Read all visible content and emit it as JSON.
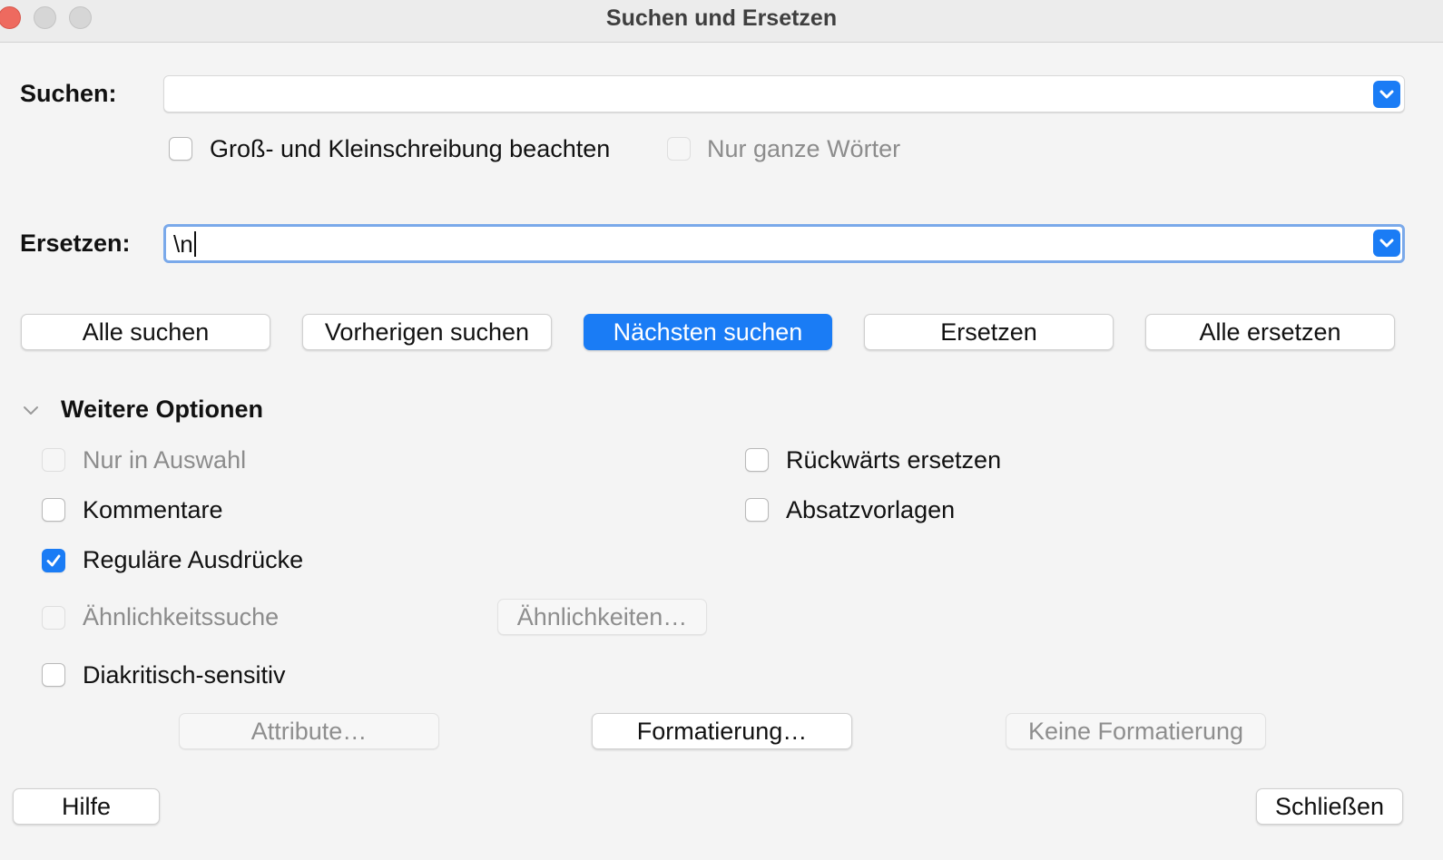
{
  "window": {
    "title": "Suchen und Ersetzen"
  },
  "search": {
    "label": "Suchen:",
    "value": "",
    "dropdown_icon": "chevron-down-icon",
    "match_case": {
      "label": "Groß- und Kleinschreibung beachten",
      "checked": false,
      "enabled": true
    },
    "whole_words": {
      "label": "Nur ganze Wörter",
      "checked": false,
      "enabled": false
    }
  },
  "replace": {
    "label": "Ersetzen:",
    "value": "\\n",
    "dropdown_icon": "chevron-down-icon"
  },
  "actions": {
    "find_all": "Alle suchen",
    "find_previous": "Vorherigen suchen",
    "find_next": "Nächsten suchen",
    "replace": "Ersetzen",
    "replace_all": "Alle ersetzen"
  },
  "more_options": {
    "title": "Weitere Optionen",
    "expanded": true,
    "current_selection_only": {
      "label": "Nur in Auswahl",
      "checked": false,
      "enabled": false
    },
    "replace_backwards": {
      "label": "Rückwärts ersetzen",
      "checked": false,
      "enabled": true
    },
    "comments": {
      "label": "Kommentare",
      "checked": false,
      "enabled": true
    },
    "paragraph_styles": {
      "label": "Absatzvorlagen",
      "checked": false,
      "enabled": true
    },
    "regular_expressions": {
      "label": "Reguläre Ausdrücke",
      "checked": true,
      "enabled": true
    },
    "similarity_search": {
      "label": "Ähnlichkeitssuche",
      "checked": false,
      "enabled": false
    },
    "similarities_button": "Ähnlichkeiten…",
    "diacritics_sensitive": {
      "label": "Diakritisch-sensitiv",
      "checked": false,
      "enabled": true
    },
    "attributes_button": "Attribute…",
    "format_button": "Formatierung…",
    "no_format_button": "Keine Formatierung"
  },
  "footer": {
    "help": "Hilfe",
    "close": "Schließen"
  },
  "colors": {
    "accent": "#1a7cf5",
    "focus_ring": "#7aa9ea",
    "background": "#f4f4f4",
    "close_light": "#ee6a5f"
  }
}
